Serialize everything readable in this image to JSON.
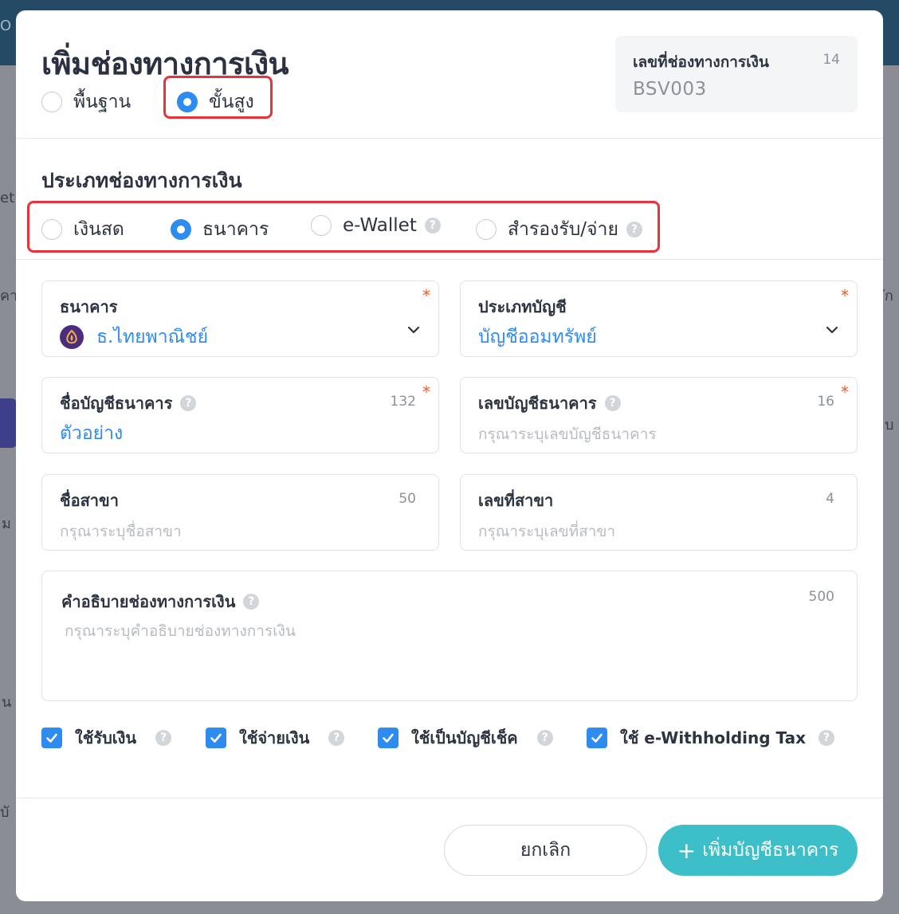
{
  "modal": {
    "title": "เพิ่มช่องทางการเงิน",
    "mode_options": [
      {
        "label": "พื้นฐาน",
        "checked": false
      },
      {
        "label": "ขั้นสูง",
        "checked": true
      }
    ],
    "code_box": {
      "label": "เลขที่ช่องทางการเงิน",
      "count": "14",
      "value": "BSV003"
    },
    "type_section": {
      "title": "ประเภทช่องทางการเงิน",
      "options": [
        {
          "label": "เงินสด",
          "checked": false
        },
        {
          "label": "ธนาคาร",
          "checked": true
        },
        {
          "label": "e-Wallet",
          "checked": false
        },
        {
          "label": "สำรองรับ/จ่าย",
          "checked": false
        }
      ]
    },
    "fields": {
      "bank": {
        "label": "ธนาคาร",
        "value": "ธ.ไทยพาณิชย์",
        "required": "*"
      },
      "account_type": {
        "label": "ประเภทบัญชี",
        "value": "บัญชีออมทรัพย์",
        "required": "*"
      },
      "account_name": {
        "label": "ชื่อบัญชีธนาคาร",
        "count": "132",
        "value": "ตัวอย่าง",
        "required": "*"
      },
      "account_number": {
        "label": "เลขบัญชีธนาคาร",
        "count": "16",
        "placeholder": "กรุณาระบุเลขบัญชีธนาคาร",
        "required": "*"
      },
      "branch_name": {
        "label": "ชื่อสาขา",
        "count": "50",
        "placeholder": "กรุณาระบุชื่อสาขา"
      },
      "branch_number": {
        "label": "เลขที่สาขา",
        "count": "4",
        "placeholder": "กรุณาระบุเลขที่สาขา"
      },
      "description": {
        "label": "คำอธิบายช่องทางการเงิน",
        "count": "500",
        "placeholder": "กรุณาระบุคำอธิบายช่องทางการเงิน"
      }
    },
    "checkboxes": [
      {
        "label": "ใช้รับเงิน",
        "checked": true
      },
      {
        "label": "ใช้จ่ายเงิน",
        "checked": true
      },
      {
        "label": "ใช้เป็นบัญชีเช็ค",
        "checked": true
      },
      {
        "label": "ใช้ e-Withholding Tax",
        "checked": true
      }
    ],
    "help_glyph": "?",
    "footer": {
      "cancel_label": "ยกเลิก",
      "add_plus": "+",
      "add_label": "เพิ่มบัญชีธนาคาร"
    }
  },
  "colors": {
    "accent": "#2e8bf0",
    "primary_button": "#3cbfc9",
    "highlight": "#e8333d",
    "required": "#ee5a24"
  },
  "background": {
    "texts": [
      "O",
      "et",
      "คา",
      "ัก",
      "บ",
      "ม",
      "น",
      "บั"
    ]
  }
}
